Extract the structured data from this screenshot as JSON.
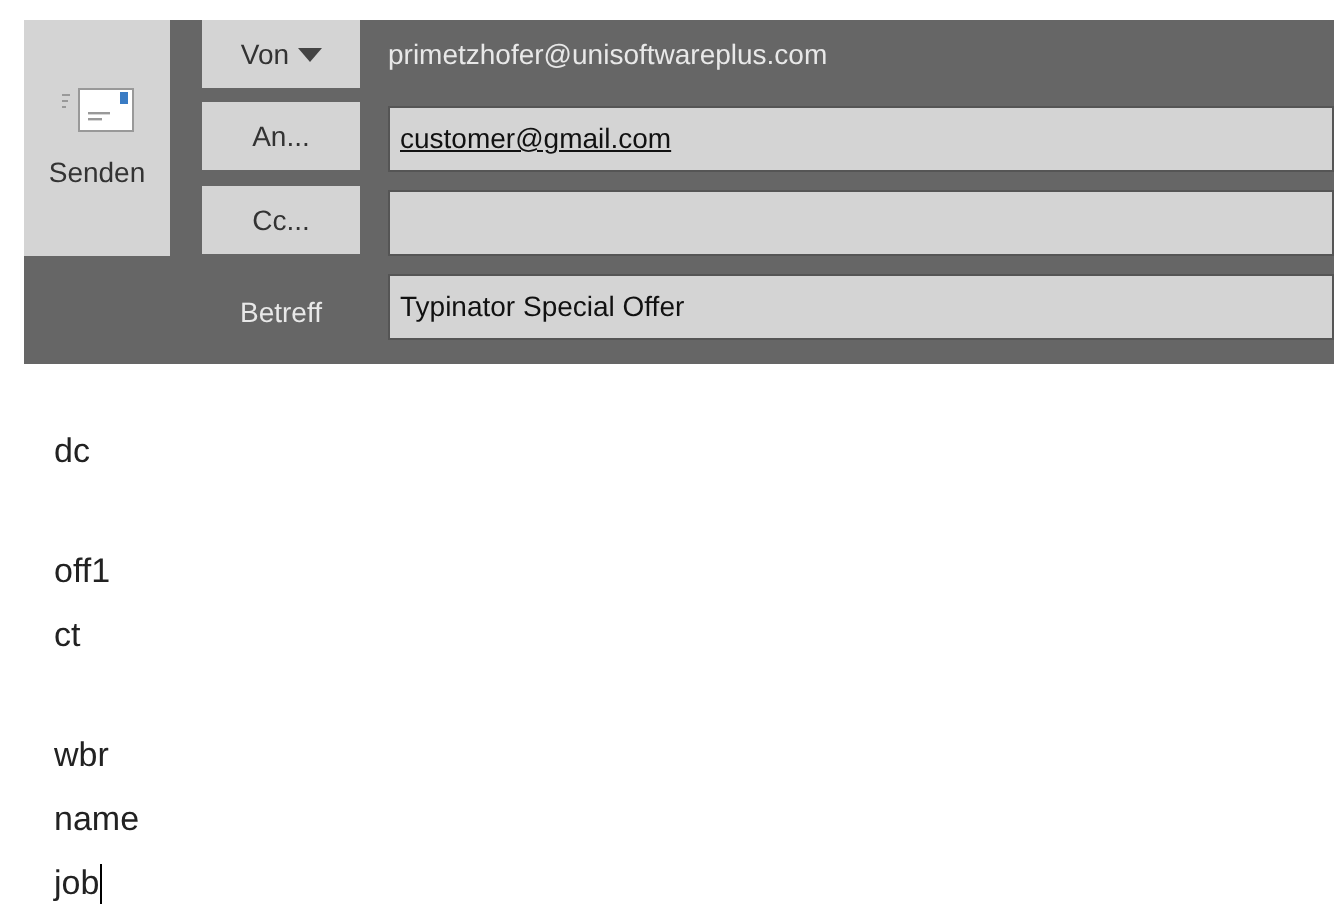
{
  "send_button": {
    "label": "Senden"
  },
  "from": {
    "button": "Von",
    "has_dropdown": true,
    "address": "primetzhofer@unisoftwareplus.com"
  },
  "to": {
    "button": "An...",
    "value": "customer@gmail.com"
  },
  "cc": {
    "button": "Cc..."
  },
  "subject": {
    "label": "Betreff",
    "value": "Typinator Special Offer"
  },
  "body": {
    "paragraphs": [
      [
        "dc"
      ],
      [
        "off1",
        "ct"
      ],
      [
        "wbr",
        "name",
        "job"
      ]
    ]
  }
}
